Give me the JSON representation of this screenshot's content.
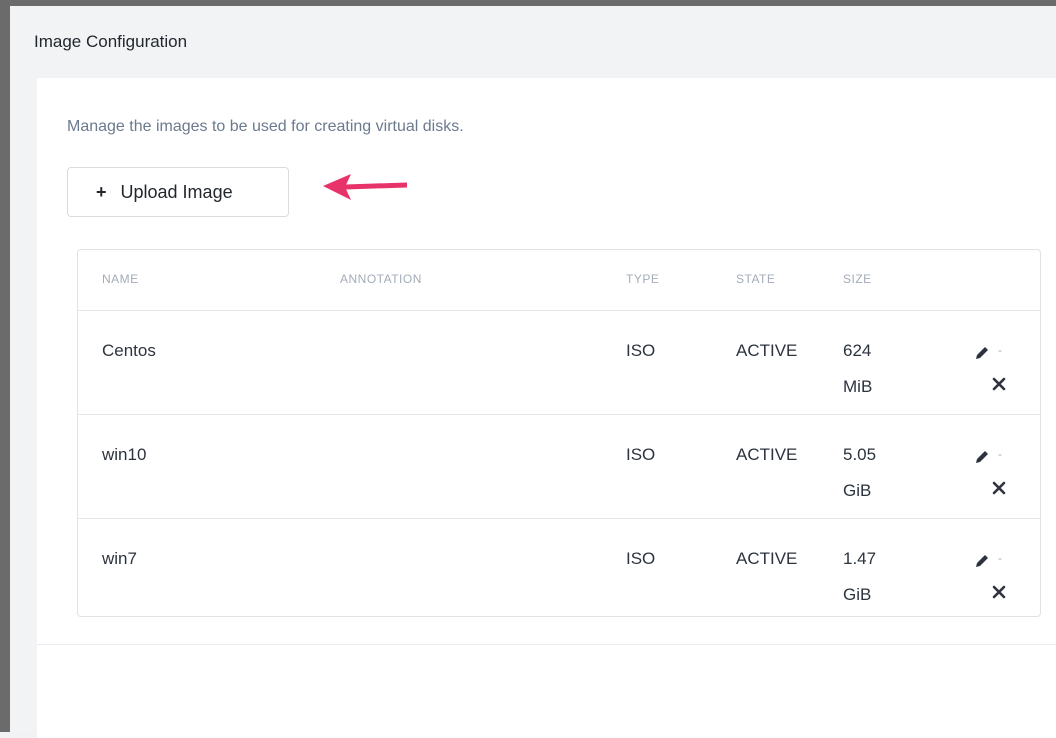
{
  "window": {
    "title": "Image Configuration"
  },
  "panel": {
    "description": "Manage the images to be used for creating virtual disks.",
    "upload_button": {
      "icon": "plus-icon",
      "label": "Upload Image"
    },
    "callout_arrow_color": "#e8336a"
  },
  "table": {
    "columns": {
      "name": "NAME",
      "annotation": "ANNOTATION",
      "type": "TYPE",
      "state": "STATE",
      "size": "SIZE"
    },
    "rows": [
      {
        "name": "Centos",
        "annotation": "",
        "type": "ISO",
        "state": "ACTIVE",
        "size": "624 MiB"
      },
      {
        "name": "win10",
        "annotation": "",
        "type": "ISO",
        "state": "ACTIVE",
        "size": "5.05 GiB"
      },
      {
        "name": "win7",
        "annotation": "",
        "type": "ISO",
        "state": "ACTIVE",
        "size": "1.47 GiB"
      }
    ],
    "row_actions": {
      "edit_icon": "pencil-icon",
      "delete_icon": "close-icon"
    }
  }
}
